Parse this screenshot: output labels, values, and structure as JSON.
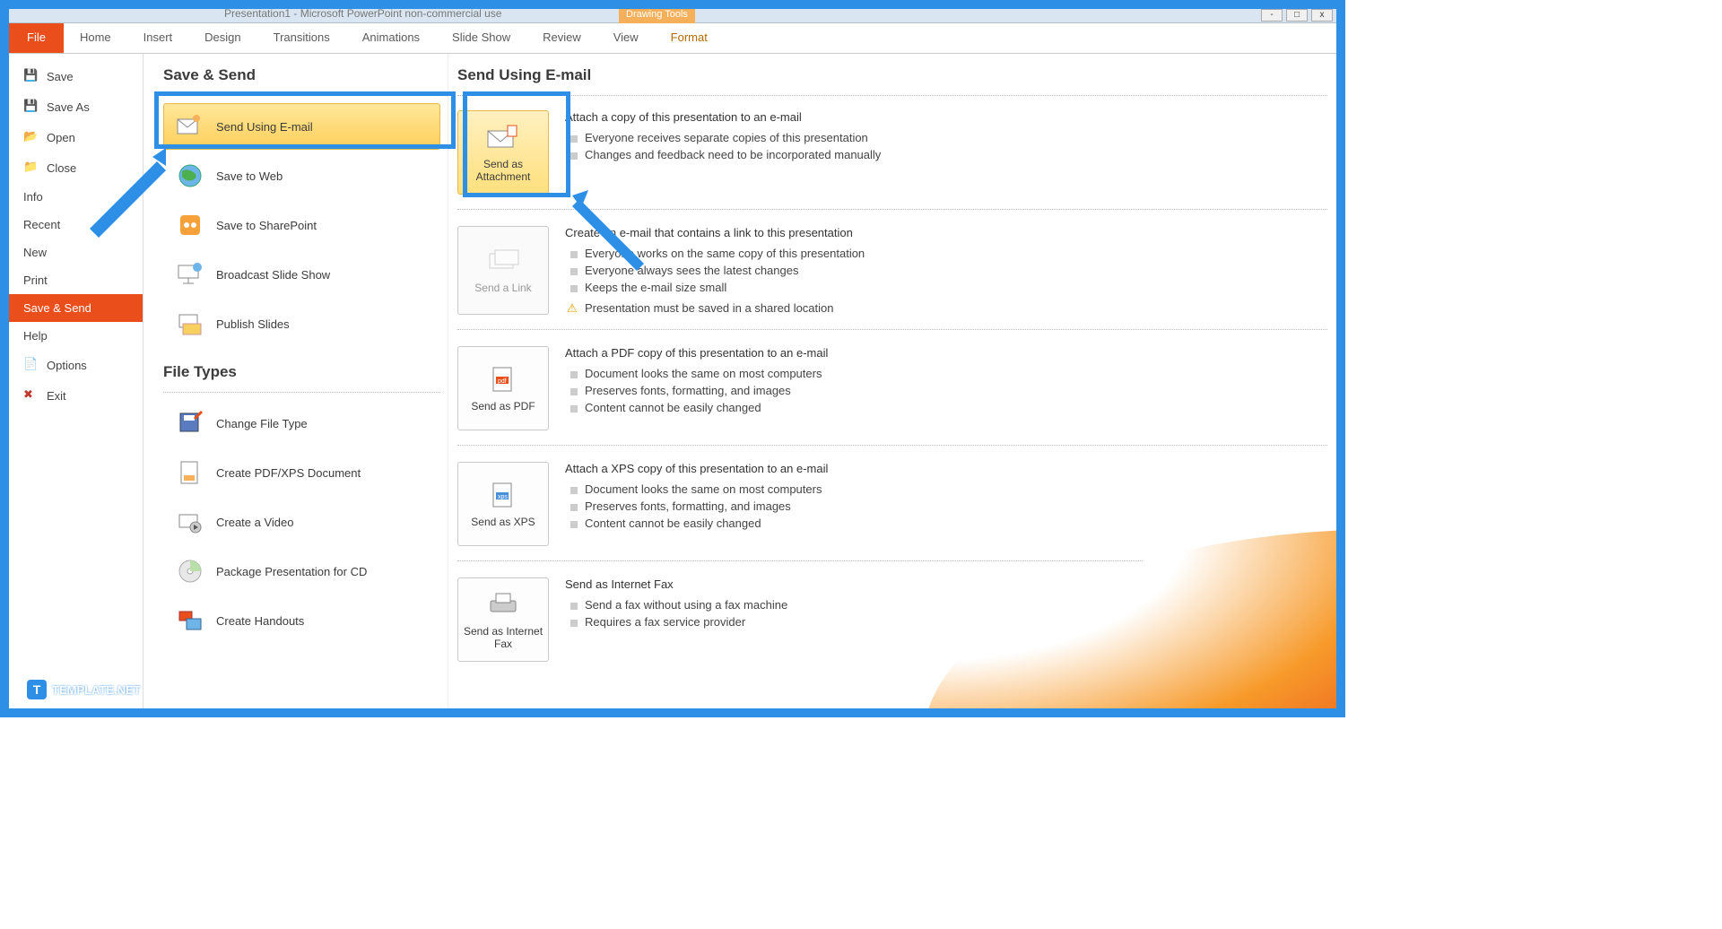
{
  "titlebar": {
    "title": "Presentation1 - Microsoft PowerPoint non-commercial use",
    "drawing_tools": "Drawing Tools"
  },
  "tabs": {
    "file": "File",
    "home": "Home",
    "insert": "Insert",
    "design": "Design",
    "transitions": "Transitions",
    "animations": "Animations",
    "slideshow": "Slide Show",
    "review": "Review",
    "view": "View",
    "format": "Format"
  },
  "nav": {
    "save": "Save",
    "saveas": "Save As",
    "open": "Open",
    "close": "Close",
    "info": "Info",
    "recent": "Recent",
    "new": "New",
    "print": "Print",
    "savesend": "Save & Send",
    "help": "Help",
    "options": "Options",
    "exit": "Exit"
  },
  "middle": {
    "heading1": "Save & Send",
    "heading2": "File Types",
    "items": {
      "send_email": "Send Using E-mail",
      "save_web": "Save to Web",
      "save_sp": "Save to SharePoint",
      "broadcast": "Broadcast Slide Show",
      "publish": "Publish Slides",
      "change_ft": "Change File Type",
      "create_pdf": "Create PDF/XPS Document",
      "create_video": "Create a Video",
      "package_cd": "Package Presentation for CD",
      "handouts": "Create Handouts"
    }
  },
  "right": {
    "heading": "Send Using E-mail",
    "blocks": {
      "attach": {
        "btn": "Send as Attachment",
        "head": "Attach a copy of this presentation to an e-mail",
        "b1": "Everyone receives separate copies of this presentation",
        "b2": "Changes and feedback need to be incorporated manually"
      },
      "link": {
        "btn": "Send a Link",
        "head": "Create an e-mail that contains a link to this presentation",
        "b1": "Everyone works on the same copy of this presentation",
        "b2": "Everyone always sees the latest changes",
        "b3": "Keeps the e-mail size small",
        "warn": "Presentation must be saved in a shared location"
      },
      "pdf": {
        "btn": "Send as PDF",
        "head": "Attach a PDF copy of this presentation to an e-mail",
        "b1": "Document looks the same on most computers",
        "b2": "Preserves fonts, formatting, and images",
        "b3": "Content cannot be easily changed"
      },
      "xps": {
        "btn": "Send as XPS",
        "head": "Attach a XPS copy of this presentation to an e-mail",
        "b1": "Document looks the same on most computers",
        "b2": "Preserves fonts, formatting, and images",
        "b3": "Content cannot be easily changed"
      },
      "fax": {
        "btn": "Send as Internet Fax",
        "head": "Send as Internet Fax",
        "b1": "Send a fax without using a fax machine",
        "b2": "Requires a fax service provider"
      }
    }
  },
  "footer": {
    "brand": "TEMPLATE.NET"
  }
}
